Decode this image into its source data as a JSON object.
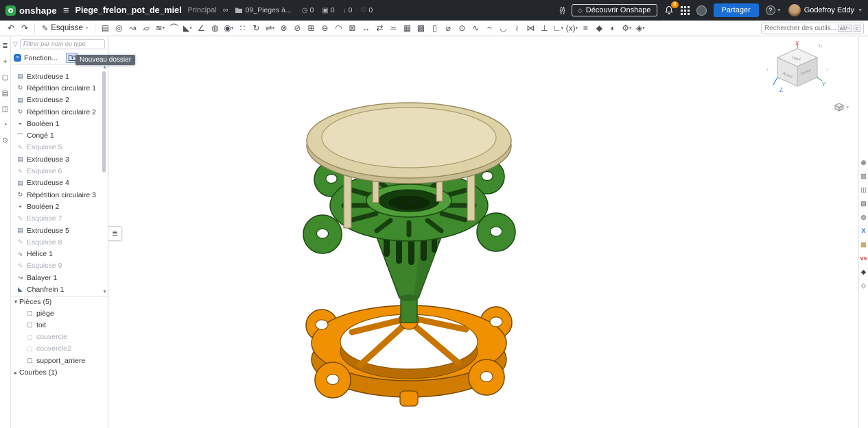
{
  "colors": {
    "accent": "#1a6dd4",
    "topbar_bg": "#23262b",
    "badge_orange": "#f28b00",
    "model_green": "#3e8a2c",
    "model_tan": "#ddd2a8",
    "model_orange": "#ef9100"
  },
  "topbar": {
    "logo_text": "onshape",
    "title": "Piege_frelon_pot_de_miel",
    "workspace": "Principal",
    "folder": "09_Pieges à...",
    "counters": [
      {
        "name": "views-count",
        "glyph": "◷",
        "value": "0"
      },
      {
        "name": "copies-count",
        "glyph": "▣",
        "value": "0"
      },
      {
        "name": "imports-count",
        "glyph": "↓",
        "value": "0"
      },
      {
        "name": "likes-count",
        "glyph": "♡",
        "value": "0"
      }
    ],
    "discover_label": "Découvrir Onshape",
    "notifications_badge": "8",
    "share_label": "Partager",
    "user_name": "Godefroy Eddy"
  },
  "toolbar": {
    "sketch_label": "Esquisse",
    "search_placeholder": "Rechercher des outils...",
    "shortcut_keys": [
      "alt/~",
      "c"
    ],
    "tools": [
      {
        "name": "extrude-tool",
        "glyph": "▤"
      },
      {
        "name": "revolve-tool",
        "glyph": "◎"
      },
      {
        "name": "sweep-tool",
        "glyph": "↝"
      },
      {
        "name": "loft-tool",
        "glyph": "▱"
      },
      {
        "name": "thicken-tool",
        "glyph": "≋",
        "caret": true
      },
      {
        "name": "fillet-tool",
        "glyph": "⌒"
      },
      {
        "name": "chamfer-tool",
        "glyph": "◣",
        "caret": true
      },
      {
        "name": "draft-tool",
        "glyph": "∠"
      },
      {
        "name": "shell-tool",
        "glyph": "◍"
      },
      {
        "name": "hole-tool",
        "glyph": "◉",
        "caret": true
      },
      {
        "name": "linear-pattern-tool",
        "glyph": "∷"
      },
      {
        "name": "circular-pattern-tool",
        "glyph": "↻"
      },
      {
        "name": "mirror-tool",
        "glyph": "⇌",
        "caret": true
      },
      {
        "name": "boolean-tool",
        "glyph": "⊗"
      },
      {
        "name": "split-tool",
        "glyph": "⊘"
      },
      {
        "name": "transform-tool",
        "glyph": "⊞"
      },
      {
        "name": "delete-part-tool",
        "glyph": "⊖"
      },
      {
        "name": "modify-fillet-tool",
        "glyph": "◠"
      },
      {
        "name": "delete-face-tool",
        "glyph": "⊠"
      },
      {
        "name": "move-face-tool",
        "glyph": "↔"
      },
      {
        "name": "replace-face-tool",
        "glyph": "⇄"
      },
      {
        "name": "offset-surface-tool",
        "glyph": "≍"
      },
      {
        "name": "boundary-surface-tool",
        "glyph": "▦"
      },
      {
        "name": "fill-surface-tool",
        "glyph": "▩"
      },
      {
        "name": "plane-tool",
        "glyph": "▯"
      },
      {
        "name": "axis-tool",
        "glyph": "⌀"
      },
      {
        "name": "point-tool",
        "glyph": "⊙"
      },
      {
        "name": "helix-tool",
        "glyph": "∿"
      },
      {
        "name": "spline-tool",
        "glyph": "~"
      },
      {
        "name": "projected-curve-tool",
        "glyph": "◡"
      },
      {
        "name": "composite-curve-tool",
        "glyph": "≀"
      },
      {
        "name": "intersection-curve-tool",
        "glyph": "⋈"
      },
      {
        "name": "trim-curve-tool",
        "glyph": "⊥"
      },
      {
        "name": "measure-tool",
        "glyph": "∟",
        "caret": true
      },
      {
        "name": "variable-tool",
        "glyph": "(x)",
        "caret": true
      },
      {
        "name": "variable-studio-tool",
        "glyph": "≡"
      },
      {
        "name": "material-tool",
        "glyph": "◆"
      },
      {
        "name": "appearance-tool",
        "glyph": "◐"
      },
      {
        "name": "custom-feature-tool",
        "glyph": "⚙",
        "caret": true
      },
      {
        "name": "featurescript-insert-tool",
        "glyph": "◈",
        "caret": true
      }
    ]
  },
  "left_strip": {
    "icons": [
      {
        "name": "panel-toggle-icon",
        "glyph": "≣"
      },
      {
        "name": "insert-icon",
        "glyph": "+"
      },
      {
        "name": "comments-icon",
        "glyph": "▢"
      },
      {
        "name": "notes-icon",
        "glyph": "▤"
      },
      {
        "name": "branch-icon",
        "glyph": "◫"
      },
      {
        "name": "history-icon",
        "glyph": "◔"
      },
      {
        "name": "search-icon",
        "glyph": "⊙"
      }
    ]
  },
  "right_strip": {
    "icons": [
      {
        "name": "user-app-icon",
        "glyph": "◉",
        "color": "#8a8f98"
      },
      {
        "name": "app-icon-2",
        "glyph": "▥",
        "color": "#8a8f98"
      },
      {
        "name": "app-icon-3",
        "glyph": "◫",
        "color": "#8a8f98"
      },
      {
        "name": "app-icon-4",
        "glyph": "▤",
        "color": "#8a8f98"
      },
      {
        "name": "app-icon-5",
        "glyph": "◍",
        "color": "#8a8f98"
      },
      {
        "name": "xometry-app-icon",
        "glyph": "X",
        "color": "#1f6fd6"
      },
      {
        "name": "app-icon-7",
        "glyph": "▦",
        "color": "#c9a06a"
      },
      {
        "name": "app-icon-8",
        "glyph": "vs",
        "color": "#d04545"
      },
      {
        "name": "app-icon-9",
        "glyph": "◆",
        "color": "#444444"
      },
      {
        "name": "app-icon-10",
        "glyph": "◇",
        "color": "#8a8f98"
      }
    ]
  },
  "feature_panel": {
    "filter_placeholder": "Filtrer par nom ou type",
    "tab_label": "Fonction...",
    "tooltip": "Nouveau dossier",
    "features": [
      {
        "glyph": "▤",
        "label": "Extrudeuse 1"
      },
      {
        "glyph": "↻",
        "label": "Répétition circulaire 1"
      },
      {
        "glyph": "▤",
        "label": "Extrudeuse 2"
      },
      {
        "glyph": "↻",
        "label": "Répétition circulaire 2"
      },
      {
        "glyph": "◓",
        "label": "Booléen 1"
      },
      {
        "glyph": "⌒",
        "label": "Congé 1"
      },
      {
        "glyph": "✎",
        "label": "Esquisse 5",
        "class": "suppressed"
      },
      {
        "glyph": "▤",
        "label": "Extrudeuse 3"
      },
      {
        "glyph": "✎",
        "label": "Esquisse 6",
        "class": "suppressed"
      },
      {
        "glyph": "▤",
        "label": "Extrudeuse 4"
      },
      {
        "glyph": "↻",
        "label": "Répétition circulaire 3"
      },
      {
        "glyph": "◓",
        "label": "Booléen 2"
      },
      {
        "glyph": "✎",
        "label": "Esquisse 7",
        "class": "suppressed"
      },
      {
        "glyph": "▤",
        "label": "Extrudeuse 5"
      },
      {
        "glyph": "✎",
        "label": "Esquisse 8",
        "class": "suppressed"
      },
      {
        "glyph": "∿",
        "label": "Hélice 1"
      },
      {
        "glyph": "✎",
        "label": "Esquisse 9",
        "class": "suppressed"
      },
      {
        "glyph": "↝",
        "label": "Balayer 1"
      },
      {
        "glyph": "◣",
        "label": "Chanfrein 1"
      }
    ],
    "parts_header": "Pièces (5)",
    "parts": [
      {
        "glyph": "▢",
        "label": "piège"
      },
      {
        "glyph": "▢",
        "label": "toit"
      },
      {
        "glyph": "▢",
        "label": "couvercle",
        "class": "suppressed"
      },
      {
        "glyph": "▢",
        "label": "couvercle2",
        "class": "suppressed"
      },
      {
        "glyph": "▢",
        "label": "support_arriere"
      }
    ],
    "curves_header": "Courbes (1)"
  },
  "viewport": {
    "axes": {
      "x": "X",
      "y": "Y",
      "z": "Z"
    },
    "cube_faces": {
      "top": "Haut",
      "front": "Avant",
      "right": "Droite"
    }
  }
}
